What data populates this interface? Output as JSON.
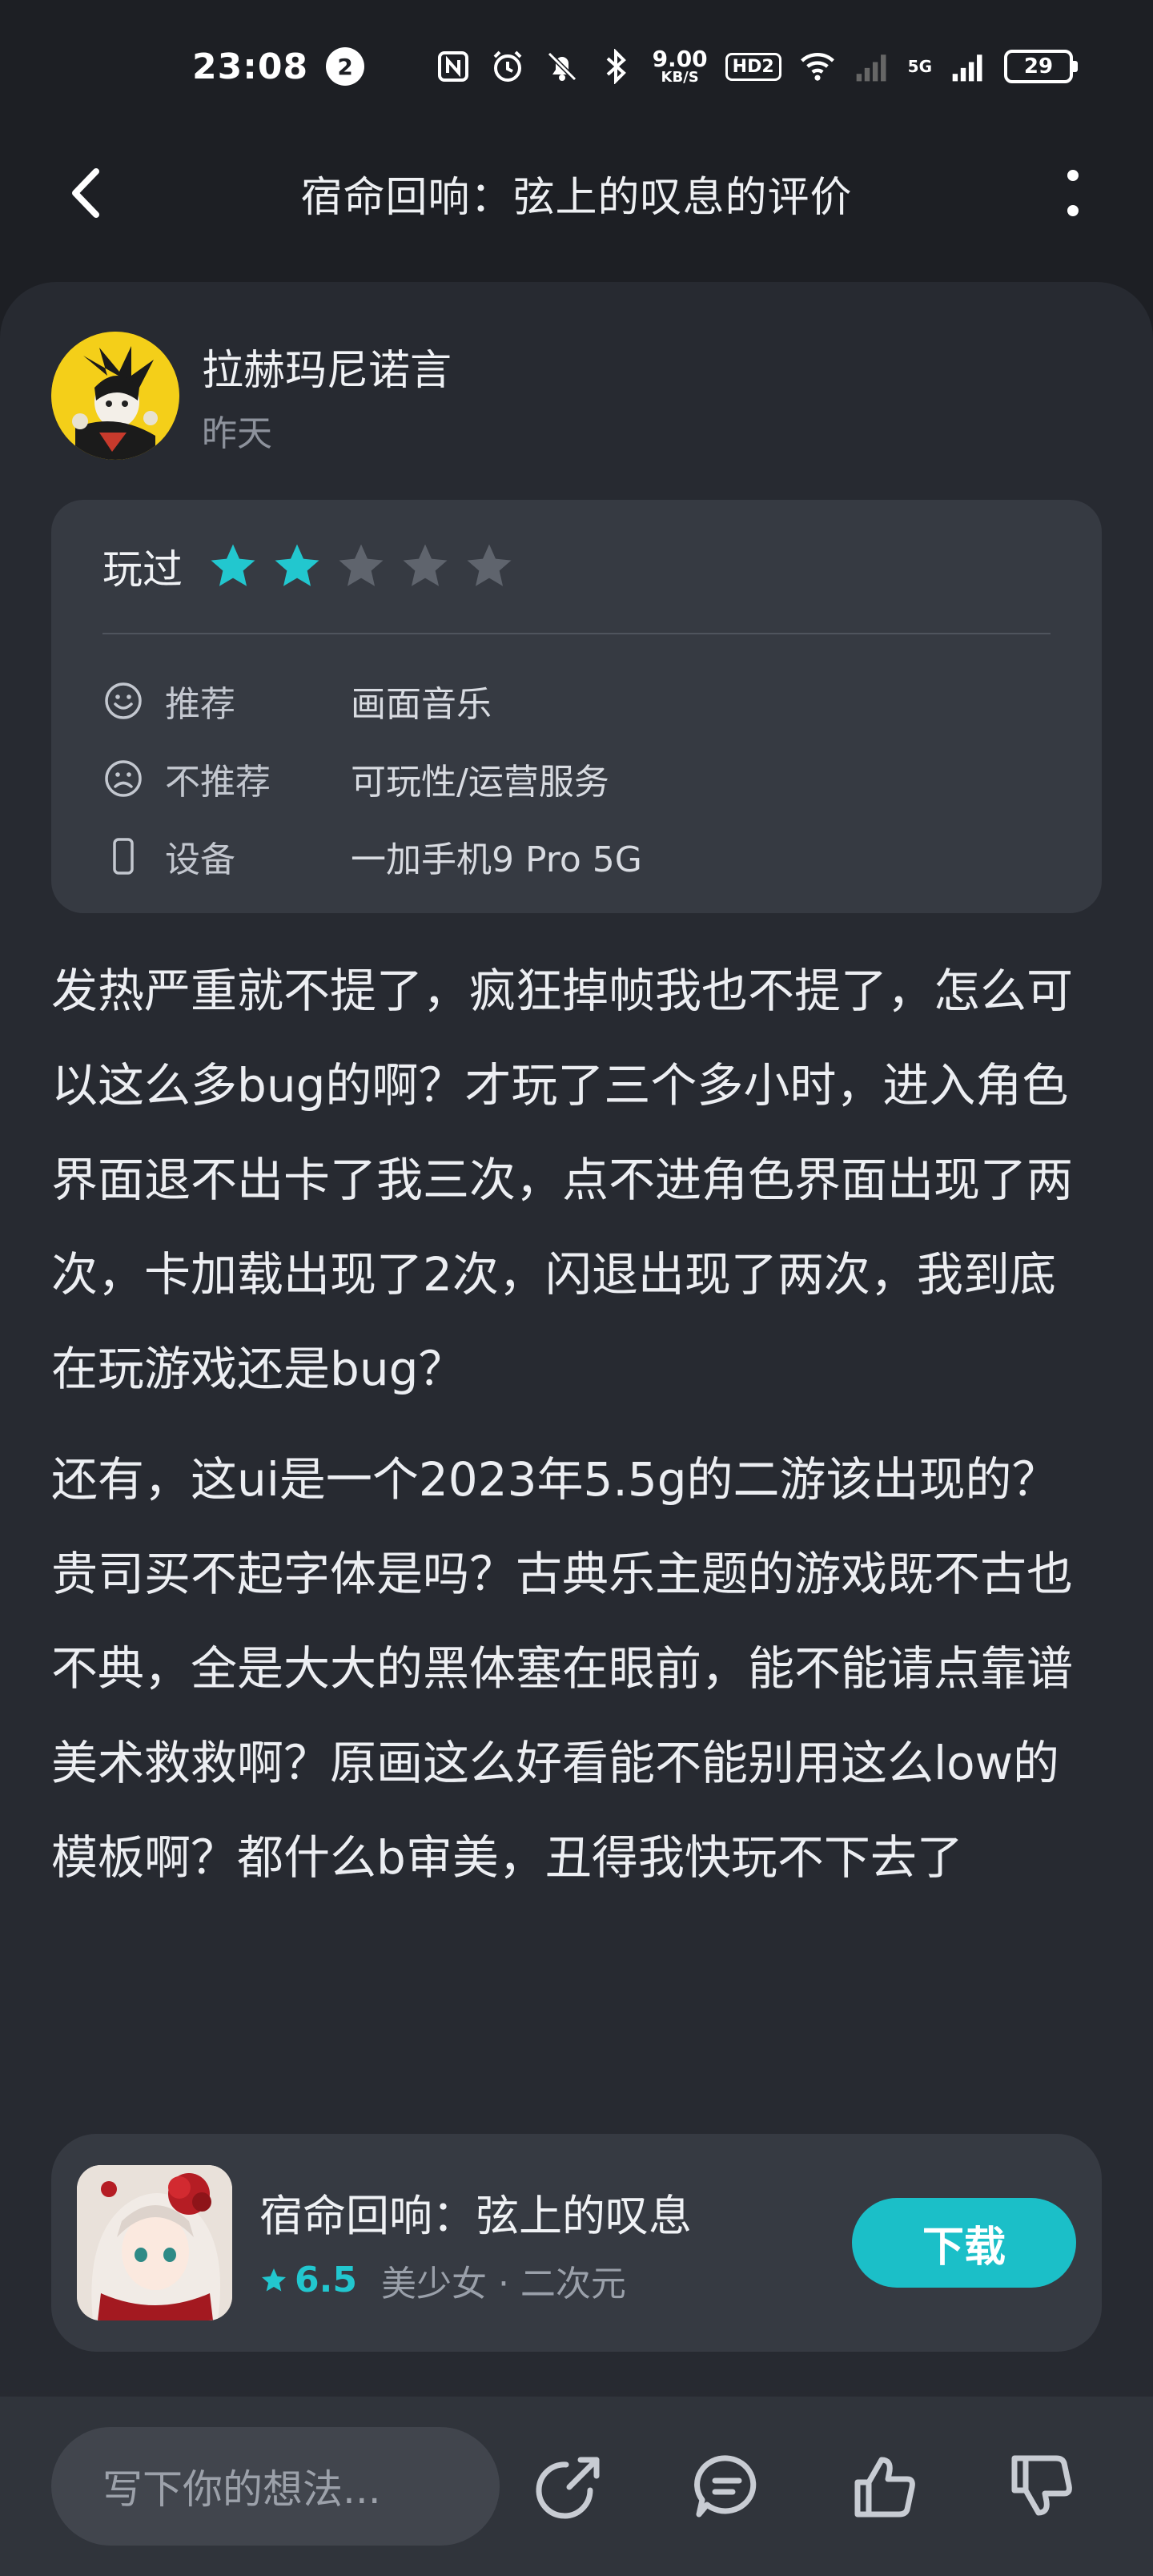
{
  "status_bar": {
    "time": "23:08",
    "notification_count": "2",
    "net_speed_value": "9.00",
    "net_speed_unit": "KB/S",
    "hd_label": "HD2",
    "network_label": "5G",
    "battery": "29"
  },
  "header": {
    "title": "宿命回响：弦上的叹息的评价"
  },
  "review": {
    "author_name": "拉赫玛尼诺言",
    "time": "昨天",
    "played_label": "玩过",
    "rating": 2,
    "max_rating": 5,
    "recommend_label": "推荐",
    "recommend_value": "画面音乐",
    "not_recommend_label": "不推荐",
    "not_recommend_value": "可玩性/运营服务",
    "device_label": "设备",
    "device_value": "一加手机9 Pro 5G",
    "paragraphs": [
      "发热严重就不提了，疯狂掉帧我也不提了，怎么可以这么多bug的啊？才玩了三个多小时，进入角色界面退不出卡了我三次，点不进角色界面出现了两次，卡加载出现了2次，闪退出现了两次，我到底在玩游戏还是bug？",
      "还有，这ui是一个2023年5.5g的二游该出现的？贵司买不起字体是吗？古典乐主题的游戏既不古也不典，全是大大的黑体塞在眼前，能不能请点靠谱美术救救啊？原画这么好看能不能别用这么low的模板啊？都什么b审美，丑得我快玩不下去了"
    ]
  },
  "game": {
    "title": "宿命回响：弦上的叹息",
    "score": "6.5",
    "tags": "美少女 · 二次元",
    "download_label": "下载"
  },
  "bottom_bar": {
    "comment_placeholder": "写下你的想法..."
  },
  "colors": {
    "accent": "#1bbfc8",
    "star_active": "#22c7cf",
    "star_inactive": "#5f646d",
    "background": "#1d1f24",
    "card": "#272a31"
  }
}
